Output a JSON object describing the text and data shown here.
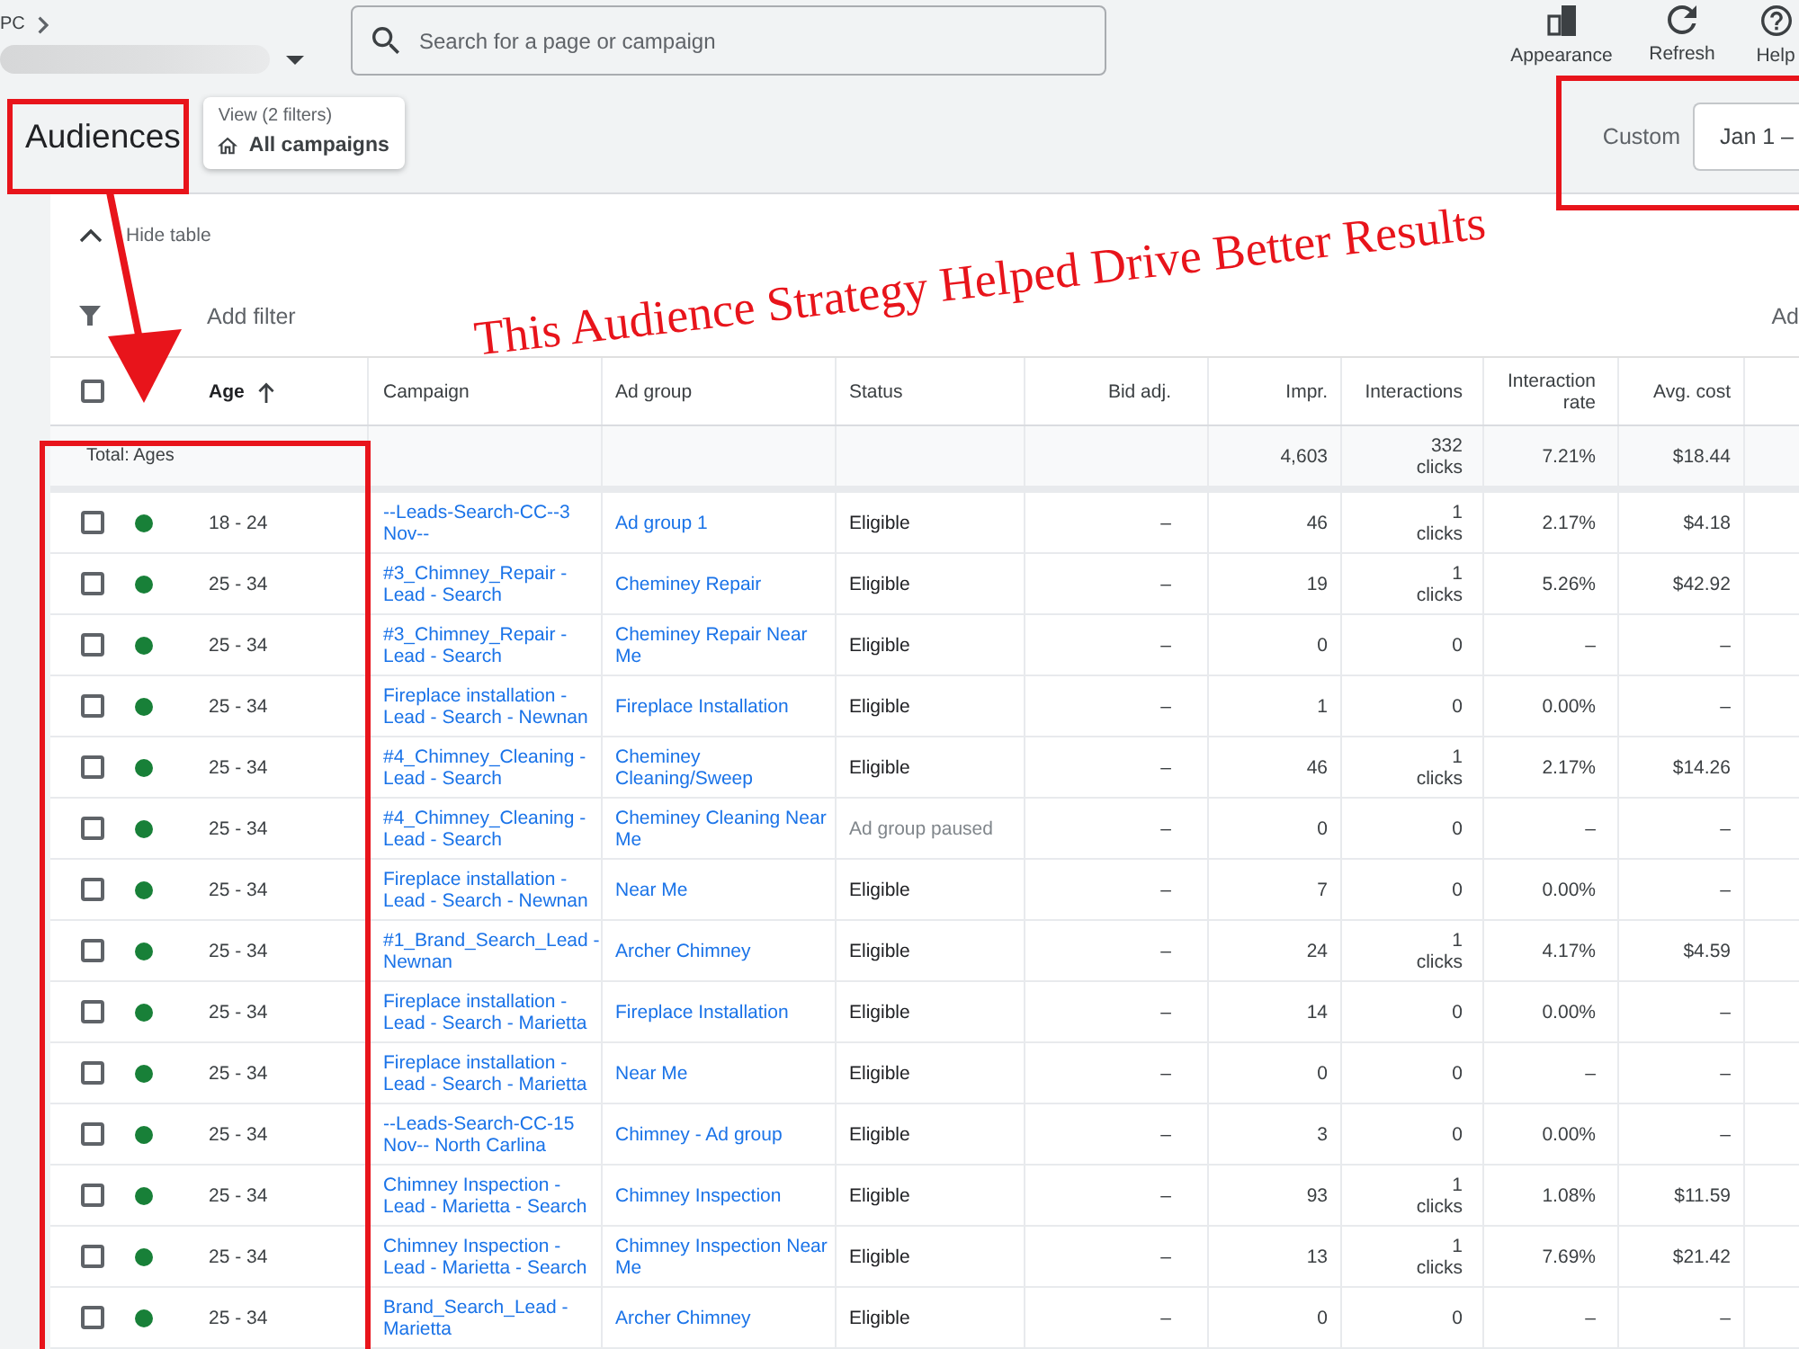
{
  "top_bar": {
    "breadcrumb": "PC",
    "search": {
      "placeholder": "Search for a page or campaign"
    },
    "actions": [
      {
        "label": "Appearance",
        "kind": "appearance"
      },
      {
        "label": "Refresh",
        "kind": "refresh"
      },
      {
        "label": "Help",
        "kind": "help"
      }
    ]
  },
  "page_header": {
    "title": "Audiences",
    "view_chip": {
      "caption": "View (2 filters)",
      "label": "All campaigns"
    },
    "date_range": {
      "label": "Custom",
      "value": "Jan 1 –"
    }
  },
  "table": {
    "hide_table": "Hide table",
    "add_filter": "Add filter",
    "right_action": "Ad",
    "select_all_checked": false,
    "columns": [
      {
        "label": "Age",
        "kind": "text",
        "sorted": true
      },
      {
        "label": "Campaign",
        "kind": "text",
        "sorted": false
      },
      {
        "label": "Ad group",
        "kind": "text",
        "sorted": false
      },
      {
        "label": "Status",
        "kind": "text",
        "sorted": false
      },
      {
        "label": "Bid adj.",
        "kind": "number",
        "sorted": false
      },
      {
        "label": "Impr.",
        "kind": "number",
        "sorted": false
      },
      {
        "label": "Interactions",
        "kind": "number",
        "sorted": false
      },
      {
        "label": "Interaction rate",
        "kind": "number",
        "sorted": false
      },
      {
        "label": "Avg. cost",
        "kind": "number",
        "sorted": false
      }
    ],
    "total": {
      "label": "Total: Ages",
      "impressions": "4,603",
      "interactions": "332 clicks",
      "interaction_rate": "7.21%",
      "avg_cost": "$18.44"
    },
    "rows": [
      {
        "checked": false,
        "color": "#188038",
        "age": "18 - 24",
        "campaign": "--Leads-Search-CC--3 Nov--",
        "ad_group": "Ad group 1",
        "status": "Eligible",
        "paused": false,
        "bid_adj": "–",
        "impressions": "46",
        "interactions": "1 clicks",
        "interaction_rate": "2.17%",
        "avg_cost": "$4.18"
      },
      {
        "checked": false,
        "color": "#188038",
        "age": "25 - 34",
        "campaign": "#3_Chimney_Repair - Lead - Search",
        "ad_group": "Cheminey Repair",
        "status": "Eligible",
        "paused": false,
        "bid_adj": "–",
        "impressions": "19",
        "interactions": "1 clicks",
        "interaction_rate": "5.26%",
        "avg_cost": "$42.92"
      },
      {
        "checked": false,
        "color": "#188038",
        "age": "25 - 34",
        "campaign": "#3_Chimney_Repair - Lead - Search",
        "ad_group": "Cheminey Repair Near Me",
        "status": "Eligible",
        "paused": false,
        "bid_adj": "–",
        "impressions": "0",
        "interactions": "0",
        "interaction_rate": "–",
        "avg_cost": "–"
      },
      {
        "checked": false,
        "color": "#188038",
        "age": "25 - 34",
        "campaign": "Fireplace installation - Lead - Search - Newnan",
        "ad_group": "Fireplace Installation",
        "status": "Eligible",
        "paused": false,
        "bid_adj": "–",
        "impressions": "1",
        "interactions": "0",
        "interaction_rate": "0.00%",
        "avg_cost": "–"
      },
      {
        "checked": false,
        "color": "#188038",
        "age": "25 - 34",
        "campaign": "#4_Chimney_Cleaning - Lead - Search",
        "ad_group": "Cheminey Cleaning/Sweep",
        "status": "Eligible",
        "paused": false,
        "bid_adj": "–",
        "impressions": "46",
        "interactions": "1 clicks",
        "interaction_rate": "2.17%",
        "avg_cost": "$14.26"
      },
      {
        "checked": false,
        "color": "#188038",
        "age": "25 - 34",
        "campaign": "#4_Chimney_Cleaning - Lead - Search",
        "ad_group": "Cheminey Cleaning Near Me",
        "status": "Ad group paused",
        "paused": true,
        "bid_adj": "–",
        "impressions": "0",
        "interactions": "0",
        "interaction_rate": "–",
        "avg_cost": "–"
      },
      {
        "checked": false,
        "color": "#188038",
        "age": "25 - 34",
        "campaign": "Fireplace installation - Lead - Search - Newnan",
        "ad_group": "Near Me",
        "status": "Eligible",
        "paused": false,
        "bid_adj": "–",
        "impressions": "7",
        "interactions": "0",
        "interaction_rate": "0.00%",
        "avg_cost": "–"
      },
      {
        "checked": false,
        "color": "#188038",
        "age": "25 - 34",
        "campaign": "#1_Brand_Search_Lead - Newnan",
        "ad_group": "Archer Chimney",
        "status": "Eligible",
        "paused": false,
        "bid_adj": "–",
        "impressions": "24",
        "interactions": "1 clicks",
        "interaction_rate": "4.17%",
        "avg_cost": "$4.59"
      },
      {
        "checked": false,
        "color": "#188038",
        "age": "25 - 34",
        "campaign": "Fireplace installation - Lead - Search - Marietta",
        "ad_group": "Fireplace Installation",
        "status": "Eligible",
        "paused": false,
        "bid_adj": "–",
        "impressions": "14",
        "interactions": "0",
        "interaction_rate": "0.00%",
        "avg_cost": "–"
      },
      {
        "checked": false,
        "color": "#188038",
        "age": "25 - 34",
        "campaign": "Fireplace installation - Lead - Search - Marietta",
        "ad_group": "Near Me",
        "status": "Eligible",
        "paused": false,
        "bid_adj": "–",
        "impressions": "0",
        "interactions": "0",
        "interaction_rate": "–",
        "avg_cost": "–"
      },
      {
        "checked": false,
        "color": "#188038",
        "age": "25 - 34",
        "campaign": "--Leads-Search-CC-15 Nov-- North Carlina",
        "ad_group": "Chimney - Ad group",
        "status": "Eligible",
        "paused": false,
        "bid_adj": "–",
        "impressions": "3",
        "interactions": "0",
        "interaction_rate": "0.00%",
        "avg_cost": "–"
      },
      {
        "checked": false,
        "color": "#188038",
        "age": "25 - 34",
        "campaign": "Chimney Inspection - Lead - Marietta - Search",
        "ad_group": "Chimney Inspection",
        "status": "Eligible",
        "paused": false,
        "bid_adj": "–",
        "impressions": "93",
        "interactions": "1 clicks",
        "interaction_rate": "1.08%",
        "avg_cost": "$11.59"
      },
      {
        "checked": false,
        "color": "#188038",
        "age": "25 - 34",
        "campaign": "Chimney Inspection - Lead - Marietta - Search",
        "ad_group": "Chimney Inspection Near Me",
        "status": "Eligible",
        "paused": false,
        "bid_adj": "–",
        "impressions": "13",
        "interactions": "1 clicks",
        "interaction_rate": "7.69%",
        "avg_cost": "$21.42"
      },
      {
        "checked": false,
        "color": "#188038",
        "age": "25 - 34",
        "campaign": "Brand_Search_Lead - Marietta",
        "ad_group": "Archer Chimney",
        "status": "Eligible",
        "paused": false,
        "bid_adj": "–",
        "impressions": "0",
        "interactions": "0",
        "interaction_rate": "–",
        "avg_cost": "–"
      }
    ]
  },
  "annotation": {
    "text": "This Audience Strategy Helped Drive Better Results",
    "highlight_title": true,
    "highlight_date_range": true,
    "highlight_age_column": true,
    "arrow": true
  }
}
